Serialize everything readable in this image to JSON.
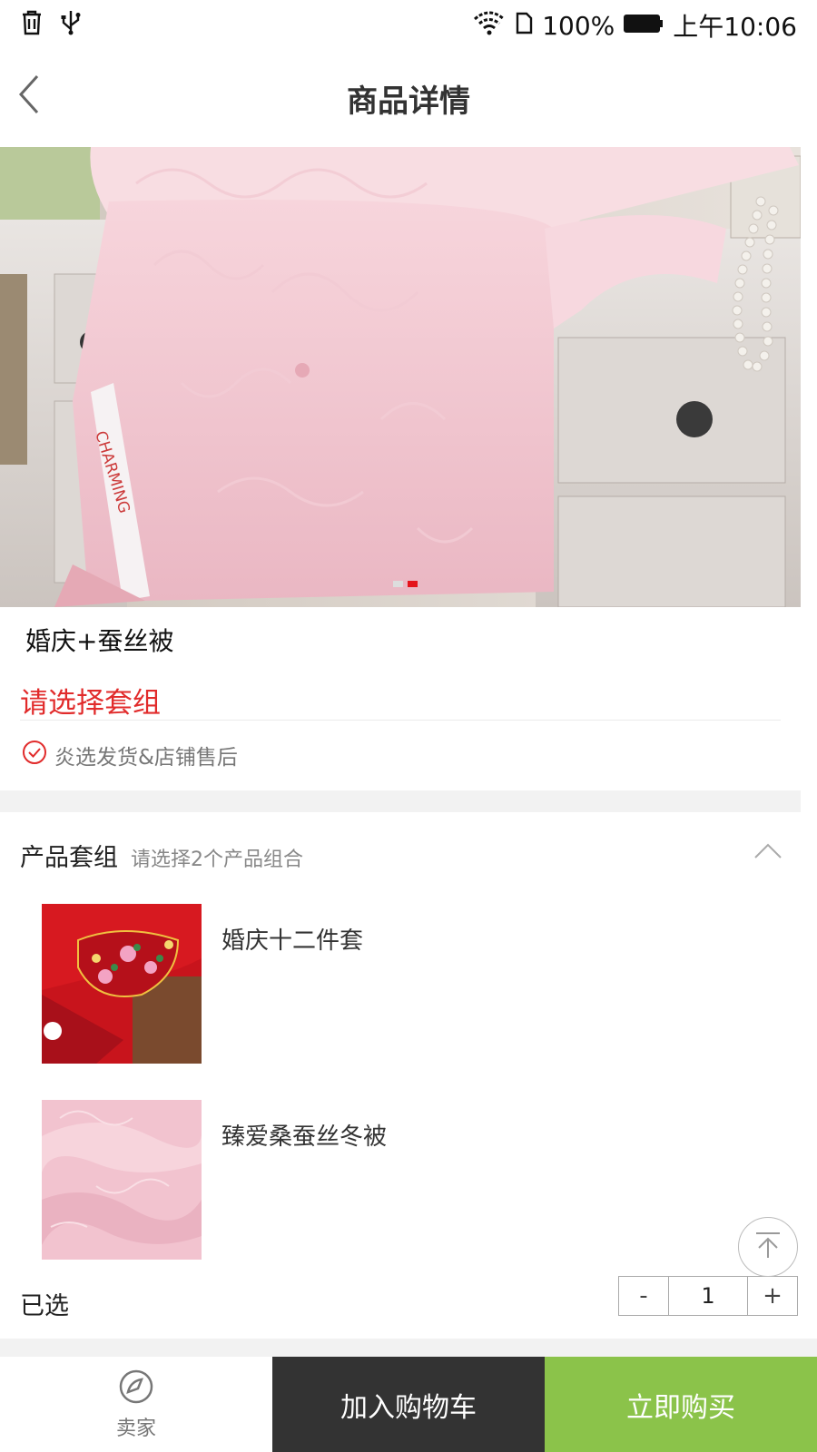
{
  "status_bar": {
    "battery": "100%",
    "time": "上午10:06",
    "icons": [
      "trash-icon",
      "usb-icon",
      "wifi-icon",
      "sim-icon",
      "battery-icon"
    ]
  },
  "header": {
    "title": "商品详情",
    "back_icon": "chevron-left-icon"
  },
  "hero": {
    "brand_text": "CHARMING",
    "slide_count": 2,
    "active_slide": 2
  },
  "product": {
    "title": "婚庆+蚕丝被",
    "select_prompt": "请选择套组",
    "service_text": "炎选发货&店铺售后",
    "service_icon": "check-circle-icon"
  },
  "bundle": {
    "title": "产品套组",
    "hint": "请选择2个产品组合",
    "collapse_icon": "chevron-up-icon",
    "items": [
      {
        "name": "婚庆十二件套",
        "thumb": "red-embroidered-bedding"
      },
      {
        "name": "臻爱桑蚕丝冬被",
        "thumb": "pink-silk-fabric"
      }
    ],
    "selected_label": "已选",
    "quantity": {
      "minus": "-",
      "value": "1",
      "plus": "+"
    }
  },
  "scroll_top_icon": "arrow-up-to-top-icon",
  "bottom_bar": {
    "seller_label": "卖家",
    "seller_icon": "seller-icon",
    "cart_label": "加入购物车",
    "buy_label": "立即购买"
  },
  "colors": {
    "accent_red": "#e12b2b",
    "cart_bg": "#333333",
    "buy_bg": "#8bc34a",
    "dot_active": "#e4141b"
  }
}
